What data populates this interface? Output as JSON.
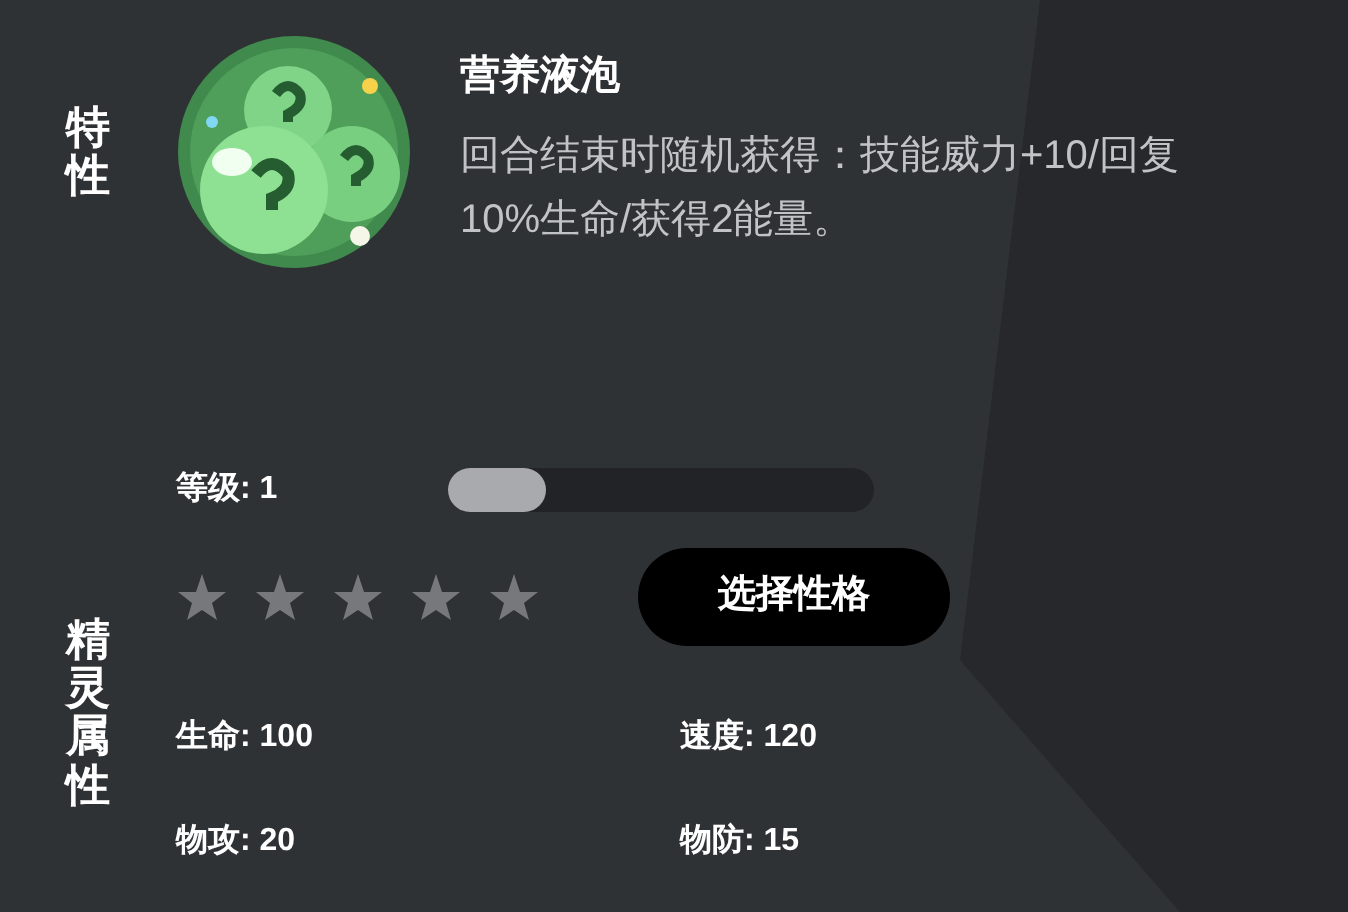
{
  "trait": {
    "section_label": "特性",
    "name": "营养液泡",
    "description": "回合结束时随机获得：技能威力+10/回复10%生命/获得2能量。"
  },
  "attributes": {
    "section_label": "精灵属性",
    "level_label": "等级: 1",
    "level": 0.23,
    "stars": 0,
    "button": "选择性格",
    "stats": [
      {
        "label": "生命: 100"
      },
      {
        "label": "速度: 120"
      },
      {
        "label": "物攻: 20"
      },
      {
        "label": "物防: 15"
      }
    ]
  }
}
